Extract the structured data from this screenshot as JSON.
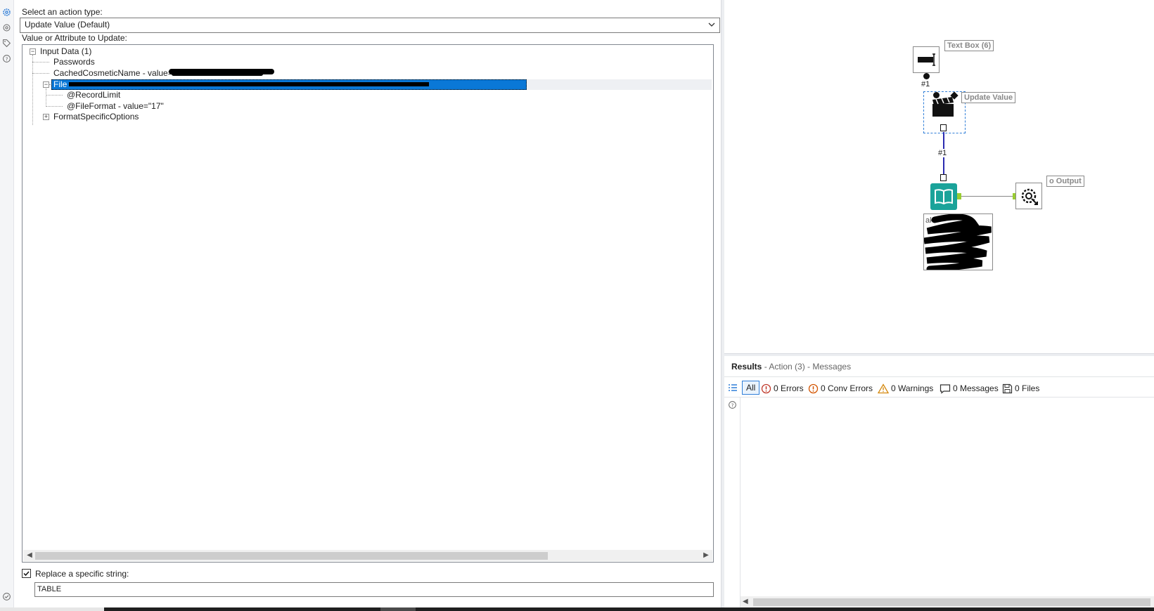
{
  "config": {
    "action_type_label": "Select an action type:",
    "action_type_value": "Update Value (Default)",
    "value_label": "Value or Attribute to Update:",
    "tree": {
      "root": "Input Data (1)",
      "passwords": "Passwords",
      "cached_name": "CachedCosmeticName - value=\"",
      "file": "File",
      "record_limit": "@RecordLimit",
      "file_format": "@FileFormat - value=\"17\"",
      "format_options": "FormatSpecificOptions"
    },
    "replace_label": "Replace a specific string:",
    "replace_checked": true,
    "replace_value": "TABLE"
  },
  "canvas": {
    "textbox_annot": "Text Box (6)",
    "textbox_conn_label": "#1",
    "action_annot": "Update Value",
    "action_conn_label": "#1",
    "output_annot": "o Output",
    "browse_label": "ak"
  },
  "results": {
    "title": "Results",
    "subtitle": "- Action (3) - Messages",
    "all_label": "All",
    "errors": "0 Errors",
    "conv_errors": "0 Conv Errors",
    "warnings": "0 Warnings",
    "messages": "0 Messages",
    "files": "0 Files"
  },
  "colors": {
    "selection": "#0a78d7",
    "accent": "#2f7ed8",
    "tool_teal": "#1aa39a",
    "connector": "#2b2bb0"
  },
  "icons": [
    "gear-icon",
    "gear-outline-icon",
    "tag-icon",
    "help-icon",
    "check-circle-icon",
    "chevron-down-icon",
    "list-icon",
    "error-icon",
    "warning-icon",
    "message-icon",
    "file-icon"
  ]
}
